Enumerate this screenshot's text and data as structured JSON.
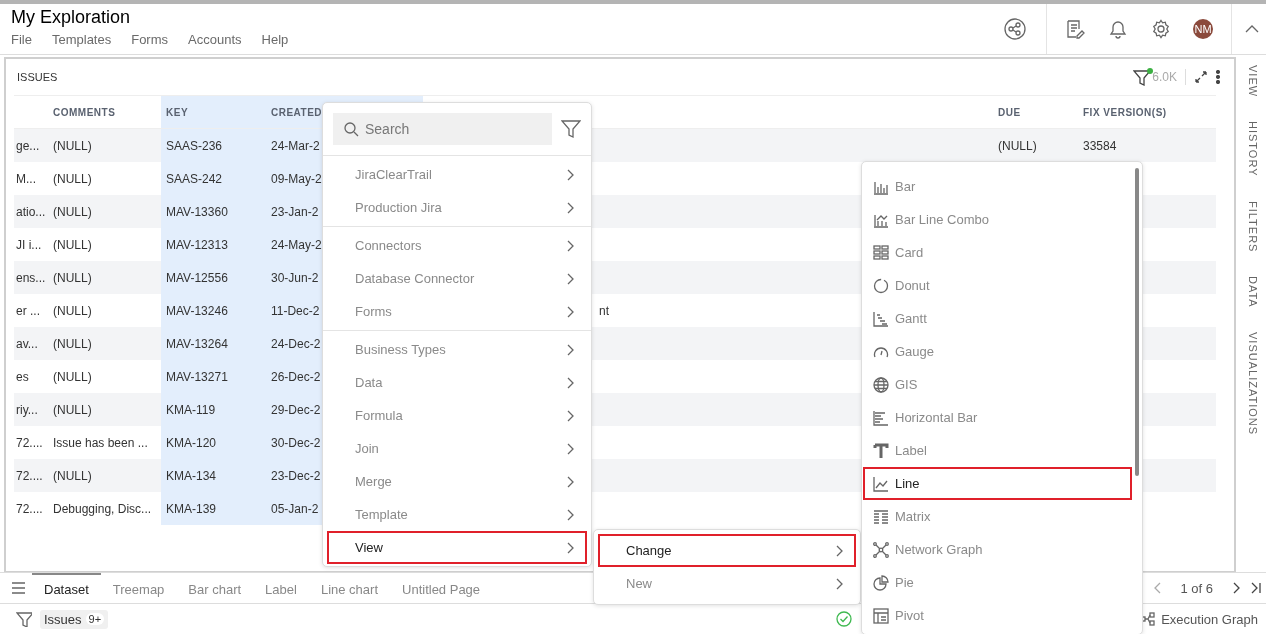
{
  "window": {
    "title": "My Exploration"
  },
  "menubar": [
    "File",
    "Templates",
    "Forms",
    "Accounts",
    "Help"
  ],
  "user": {
    "initials": "NM"
  },
  "panel": {
    "title": "ISSUES",
    "row_count": "6.0K",
    "filter_active": true
  },
  "table": {
    "columns": [
      {
        "highlighted": false
      },
      {
        "label": "COMMENTS",
        "highlighted": false
      },
      {
        "label": "KEY",
        "highlighted": true
      },
      {
        "label": "CREATED",
        "highlighted": true
      },
      {
        "highlighted": false
      },
      {
        "label": "DUE",
        "highlighted": false
      },
      {
        "label": "FIX VERSION(S)",
        "highlighted": false
      }
    ],
    "rows": [
      [
        "ge...",
        "(NULL)",
        "SAAS-236",
        "24-Mar-2",
        null,
        "(NULL)",
        "33584"
      ],
      [
        "M...",
        "(NULL)",
        "SAAS-242",
        "09-May-2",
        null,
        null,
        null
      ],
      [
        "atio...",
        "(NULL)",
        "MAV-13360",
        "23-Jan-2",
        null,
        null,
        null
      ],
      [
        "JI i...",
        "(NULL)",
        "MAV-12313",
        "24-May-2",
        null,
        null,
        null
      ],
      [
        "ens...",
        "(NULL)",
        "MAV-12556",
        "30-Jun-2",
        null,
        null,
        null
      ],
      [
        "er ...",
        "(NULL)",
        "MAV-13246",
        "11-Dec-2",
        "nt",
        null,
        null
      ],
      [
        "av...",
        "(NULL)",
        "MAV-13264",
        "24-Dec-2",
        null,
        null,
        null
      ],
      [
        "es",
        "(NULL)",
        "MAV-13271",
        "26-Dec-2",
        null,
        null,
        null
      ],
      [
        "riy...",
        "(NULL)",
        "KMA-119",
        "29-Dec-2",
        null,
        null,
        null
      ],
      [
        "72....",
        "Issue has been ...",
        "KMA-120",
        "30-Dec-2",
        null,
        null,
        null
      ],
      [
        "72....",
        "(NULL)",
        "KMA-134",
        "23-Dec-2",
        null,
        null,
        null
      ],
      [
        "72....",
        "Debugging, Disc...",
        "KMA-139",
        "05-Jan-2",
        null,
        null,
        null
      ]
    ]
  },
  "side_tabs": [
    "VIEW",
    "HISTORY",
    "FILTERS",
    "DATA",
    "VISUALIZATIONS"
  ],
  "page_tabs": [
    {
      "label": "Dataset",
      "selected": true
    },
    {
      "label": "Treemap",
      "selected": false
    },
    {
      "label": "Bar chart",
      "selected": false
    },
    {
      "label": "Label",
      "selected": false
    },
    {
      "label": "Line chart",
      "selected": false
    },
    {
      "label": "Untitled Page",
      "selected": false
    }
  ],
  "pager": "1 of 6",
  "status_bar": {
    "chip": {
      "label": "Issues",
      "badge": "9+"
    },
    "execution_graph": "Execution Graph"
  },
  "source_menu": {
    "search": {
      "placeholder": "Search"
    },
    "sections": [
      [
        {
          "label": "JiraClearTrail",
          "selected": false
        },
        {
          "label": "Production Jira",
          "selected": false
        }
      ],
      [
        {
          "label": "Connectors",
          "selected": false
        },
        {
          "label": "Database Connector",
          "selected": false
        },
        {
          "label": "Forms",
          "selected": false
        }
      ],
      [
        {
          "label": "Business Types",
          "selected": false
        },
        {
          "label": "Data",
          "selected": false
        },
        {
          "label": "Formula",
          "selected": false
        },
        {
          "label": "Join",
          "selected": false
        },
        {
          "label": "Merge",
          "selected": false
        },
        {
          "label": "Template",
          "selected": false
        },
        {
          "label": "View",
          "selected": true
        }
      ]
    ]
  },
  "view_menu": [
    {
      "label": "Change",
      "selected": true
    },
    {
      "label": "New",
      "selected": false
    }
  ],
  "chart_menu": [
    {
      "label": "Bar",
      "selected": false
    },
    {
      "label": "Bar Line Combo",
      "selected": false
    },
    {
      "label": "Card",
      "selected": false
    },
    {
      "label": "Donut",
      "selected": false
    },
    {
      "label": "Gantt",
      "selected": false
    },
    {
      "label": "Gauge",
      "selected": false
    },
    {
      "label": "GIS",
      "selected": false
    },
    {
      "label": "Horizontal Bar",
      "selected": false
    },
    {
      "label": "Label",
      "selected": false
    },
    {
      "label": "Line",
      "selected": true
    },
    {
      "label": "Matrix",
      "selected": false
    },
    {
      "label": "Network Graph",
      "selected": false
    },
    {
      "label": "Pie",
      "selected": false
    },
    {
      "label": "Pivot",
      "selected": false
    }
  ]
}
